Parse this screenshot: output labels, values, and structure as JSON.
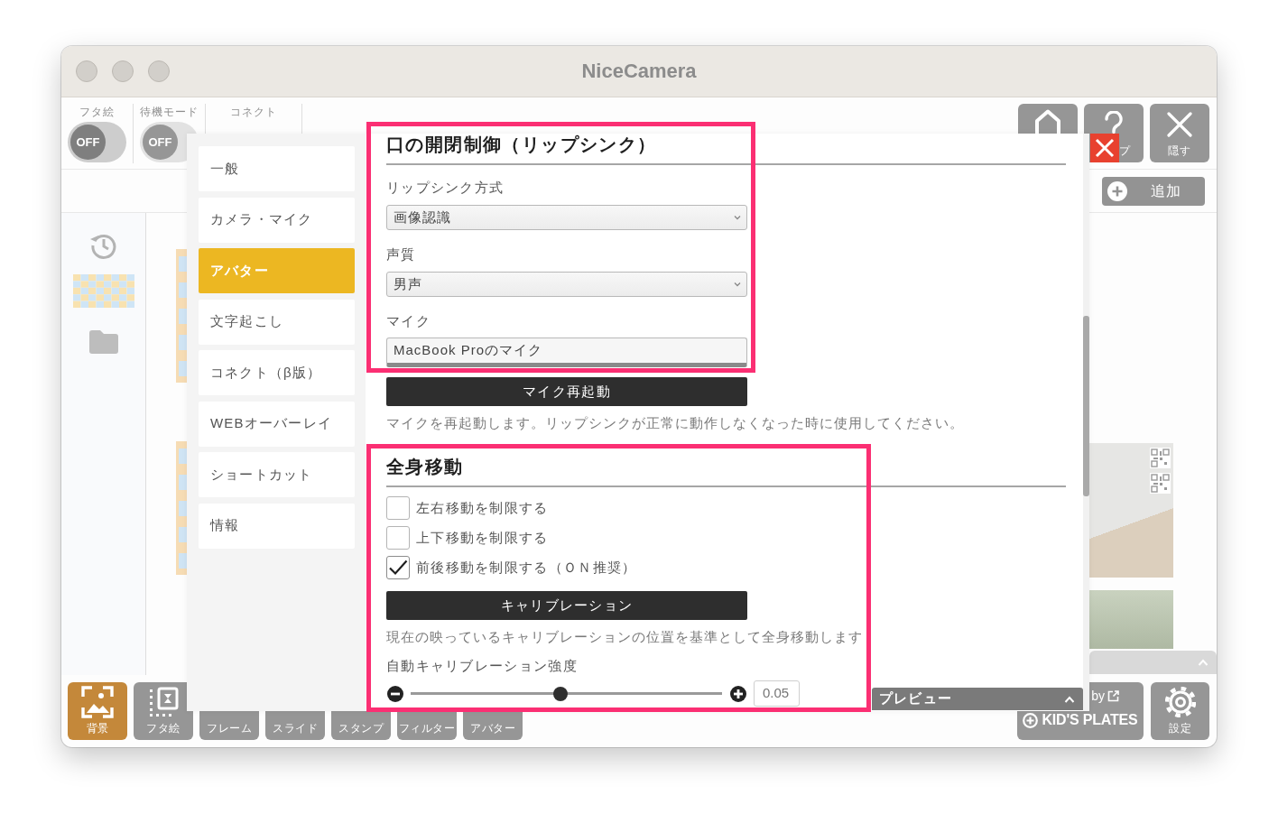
{
  "window": {
    "title": "NiceCamera"
  },
  "top_toolbar": {
    "toggles": [
      {
        "label": "フタ絵",
        "text": "OFF",
        "on": false,
        "disabled": false
      },
      {
        "label": "待機モード",
        "text": "OFF",
        "on": false,
        "disabled": true
      }
    ],
    "connect_label": "コネクト",
    "buttons": [
      {
        "kind": "home"
      },
      {
        "kind": "help",
        "label": "プ"
      },
      {
        "kind": "hide",
        "label": "隠す"
      }
    ]
  },
  "add_button": {
    "label": "追加"
  },
  "bottom_toolbar": {
    "tabs": [
      {
        "kind": "background",
        "label": "背景",
        "selected": true
      },
      {
        "kind": "cover",
        "label": "フタ絵",
        "selected": false
      },
      {
        "label": "フレーム",
        "selected": false
      },
      {
        "label": "スライド",
        "selected": false
      },
      {
        "label": "スタンプ",
        "selected": false
      },
      {
        "label": "フィルター",
        "selected": false
      },
      {
        "label": "アバター",
        "selected": false
      }
    ],
    "brand_button": {
      "by": "by",
      "label": "KID'S PLATES"
    },
    "settings_button": {
      "label": "設定"
    }
  },
  "settings_dialog": {
    "nav": [
      {
        "label": "一般",
        "selected": false
      },
      {
        "label": "カメラ・マイク",
        "selected": false
      },
      {
        "label": "アバター",
        "selected": true
      },
      {
        "label": "文字起こし",
        "selected": false
      },
      {
        "label": "コネクト（β版）",
        "selected": false
      },
      {
        "label": "WEBオーバーレイ",
        "selected": false
      },
      {
        "label": "ショートカット",
        "selected": false
      },
      {
        "label": "情報",
        "selected": false
      }
    ],
    "sections": [
      {
        "blocks": [
          {
            "highlighted": true,
            "items": [
              {
                "kind": "heading",
                "text": "口の開閉制御（リップシンク）"
              },
              {
                "kind": "select",
                "label": "リップシンク方式",
                "value": "画像認識"
              },
              {
                "kind": "select",
                "label": "声質",
                "value": "男声"
              },
              {
                "kind": "input",
                "label": "マイク",
                "value": "MacBook Proのマイク"
              }
            ]
          },
          {
            "highlighted": false,
            "items": [
              {
                "kind": "button",
                "label": "マイク再起動"
              },
              {
                "kind": "note",
                "text": "マイクを再起動します。リップシンクが正常に動作しなくなった時に使用してください。"
              }
            ]
          }
        ]
      },
      {
        "blocks": [
          {
            "highlighted": true,
            "items": [
              {
                "kind": "heading",
                "text": "全身移動"
              },
              {
                "kind": "checkbox",
                "label": "左右移動を制限する",
                "checked": false
              },
              {
                "kind": "checkbox",
                "label": "上下移動を制限する",
                "checked": false
              },
              {
                "kind": "checkbox",
                "label": "前後移動を制限する（ＯＮ推奨）",
                "checked": true
              },
              {
                "kind": "button",
                "label": "キャリブレーション"
              },
              {
                "kind": "note",
                "text": "現在の映っているキャリブレーションの位置を基準として全身移動します"
              },
              {
                "kind": "slider",
                "label": "自動キャリブレーション強度",
                "level": 0.48,
                "reading": "0.05"
              }
            ]
          }
        ]
      }
    ]
  },
  "preview_bar": {
    "label": "プレビュー"
  }
}
